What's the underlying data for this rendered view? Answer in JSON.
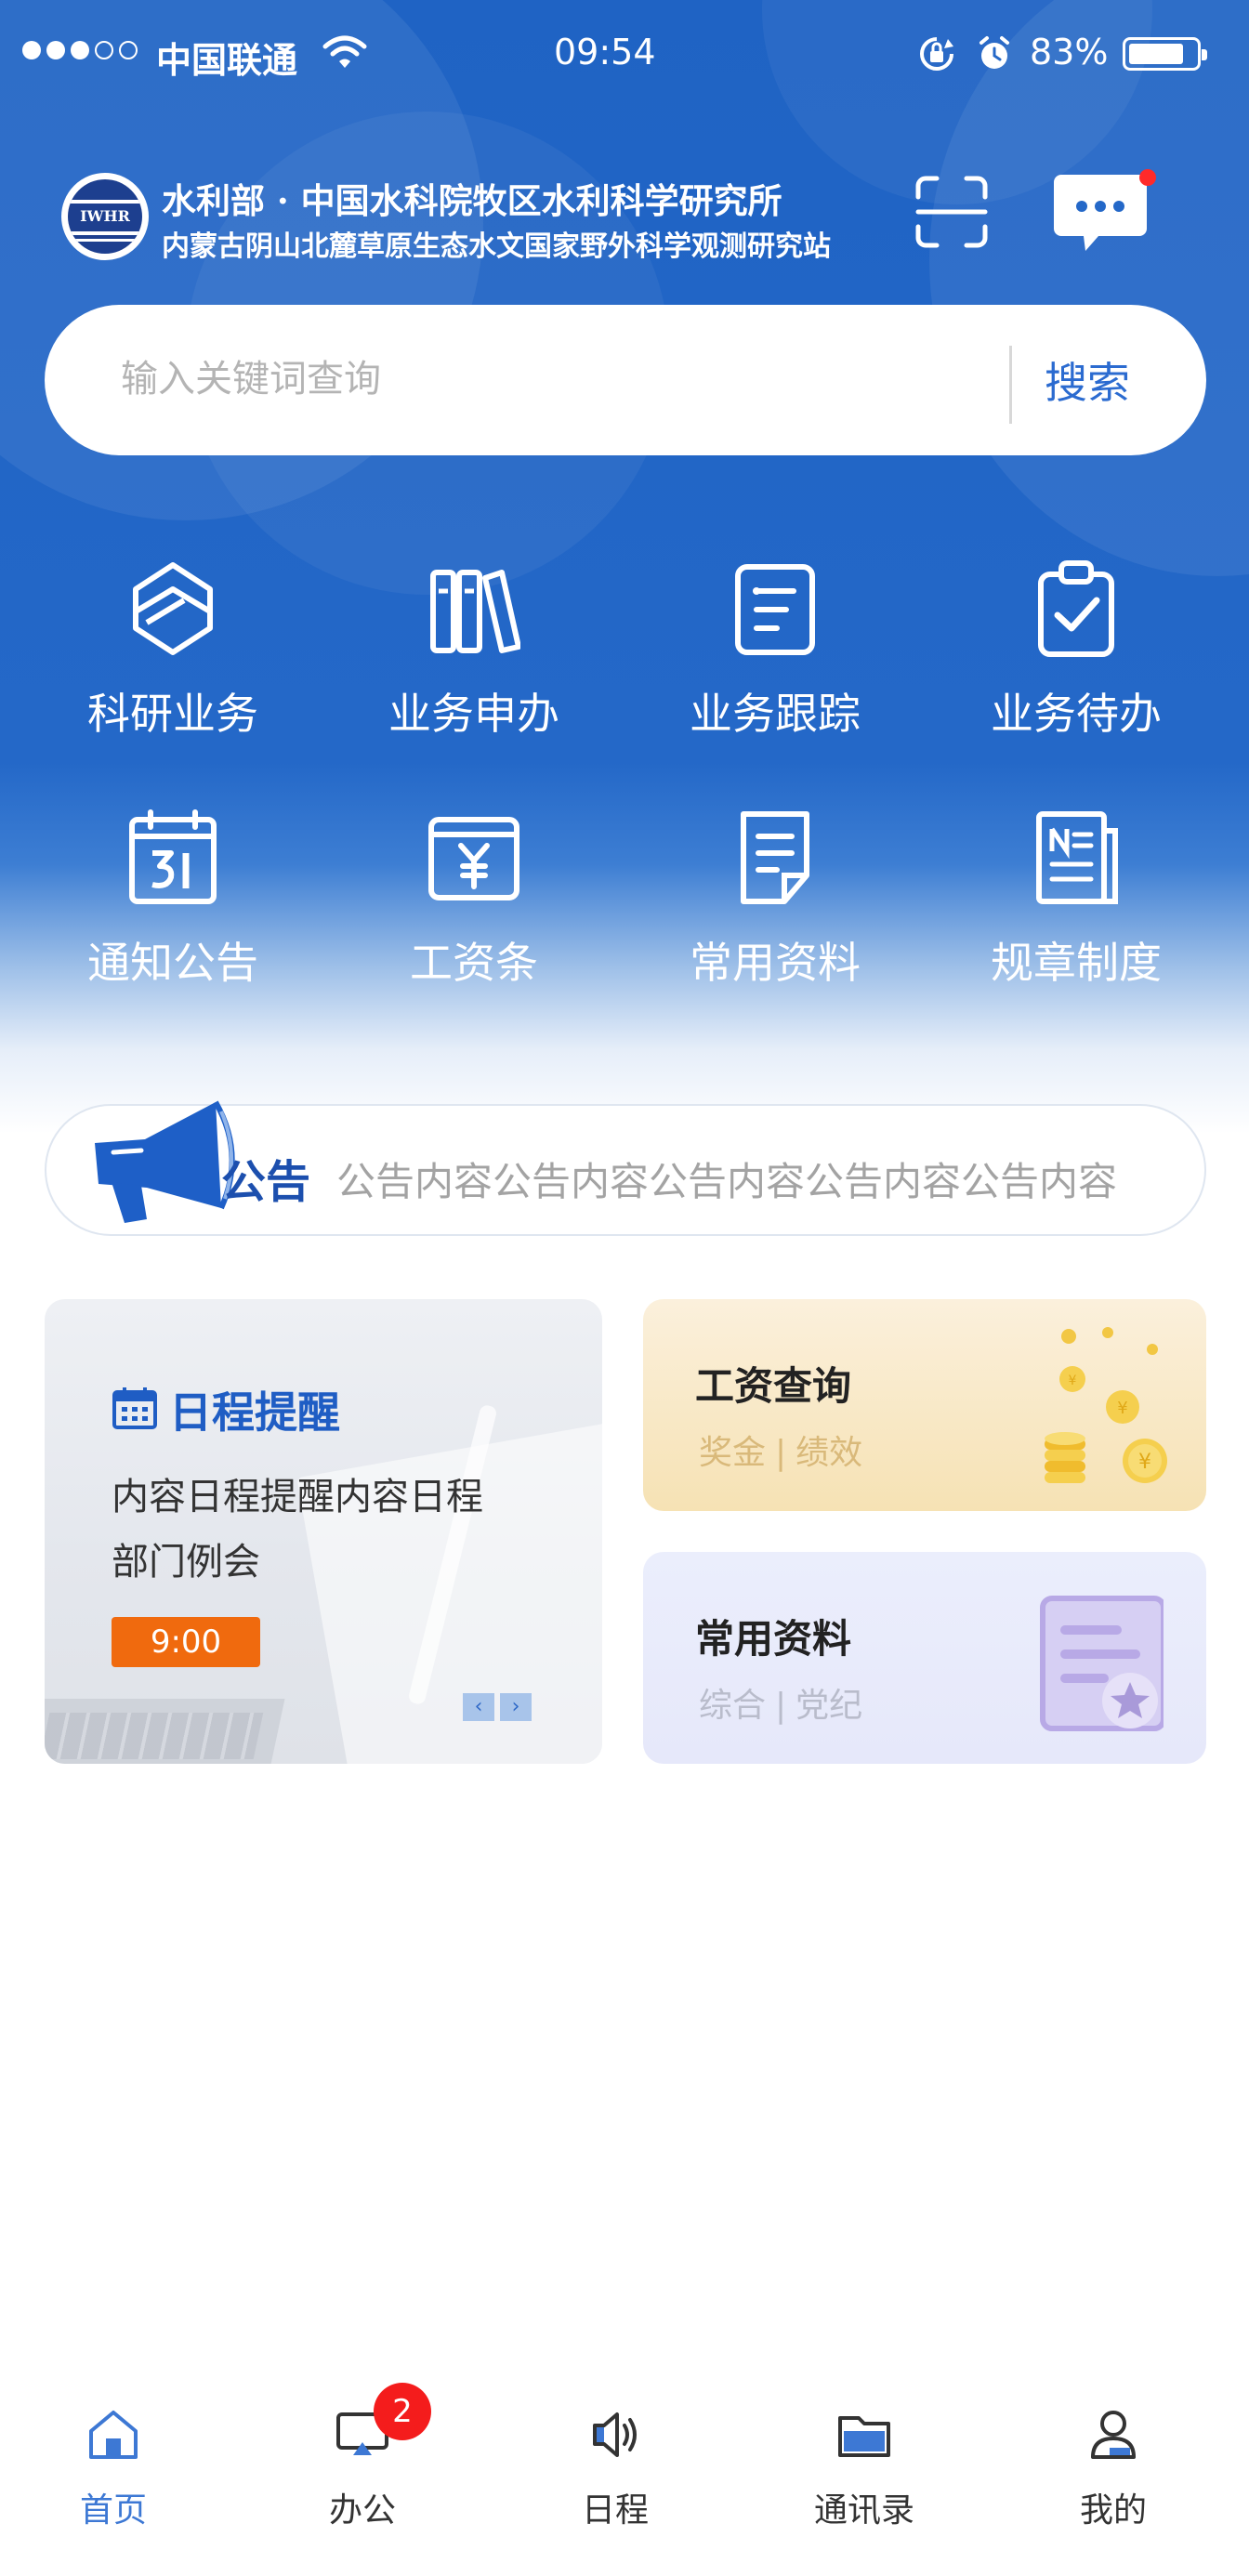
{
  "status_bar": {
    "carrier": "中国联通",
    "time": "09:54",
    "battery_percent": "83%",
    "battery_level": 0.83,
    "signal_bars_filled": 3,
    "signal_bars_total": 5
  },
  "header": {
    "org_title": "水利部 · 中国水科院牧区水利科学研究所",
    "org_subtitle": "内蒙古阴山北麓草原生态水文国家野外科学观测研究站",
    "logo_text": "IWHR",
    "scan_icon": "scan-icon",
    "message_icon": "message-icon"
  },
  "search": {
    "placeholder": "输入关键词查询",
    "button_label": "搜索"
  },
  "functions": [
    {
      "label": "科研业务",
      "icon": "research-icon"
    },
    {
      "label": "业务申办",
      "icon": "books-icon"
    },
    {
      "label": "业务跟踪",
      "icon": "tracking-icon"
    },
    {
      "label": "业务待办",
      "icon": "clipboard-check-icon"
    },
    {
      "label": "通知公告",
      "icon": "calendar-notice-icon"
    },
    {
      "label": "工资条",
      "icon": "salary-slip-icon"
    },
    {
      "label": "常用资料",
      "icon": "document-icon"
    },
    {
      "label": "规章制度",
      "icon": "regulations-icon"
    }
  ],
  "notice": {
    "title": "公告",
    "content": "公告内容公告内容公告内容公告内容公告内容",
    "icon": "megaphone-icon"
  },
  "schedule_card": {
    "title": "日程提醒",
    "line1": "内容日程提醒内容日程",
    "line2": "部门例会",
    "time": "9:00",
    "prev": "‹",
    "next": "›"
  },
  "salary_card": {
    "title": "工资查询",
    "sub_a": "奖金",
    "sub_b": "绩效",
    "separator": "|"
  },
  "docs_card": {
    "title": "常用资料",
    "sub_a": "综合",
    "sub_b": "党纪",
    "separator": "|"
  },
  "tabbar": [
    {
      "label": "首页",
      "icon": "home-icon",
      "active": true
    },
    {
      "label": "办公",
      "icon": "office-icon",
      "badge": "2"
    },
    {
      "label": "日程",
      "icon": "speaker-icon"
    },
    {
      "label": "通讯录",
      "icon": "folder-icon"
    },
    {
      "label": "我的",
      "icon": "user-icon"
    }
  ],
  "colors": {
    "primary_blue": "#2468c8",
    "accent_text_blue": "#2b6bd0",
    "time_badge_orange": "#f06a0e",
    "badge_red": "#f41c1c"
  }
}
